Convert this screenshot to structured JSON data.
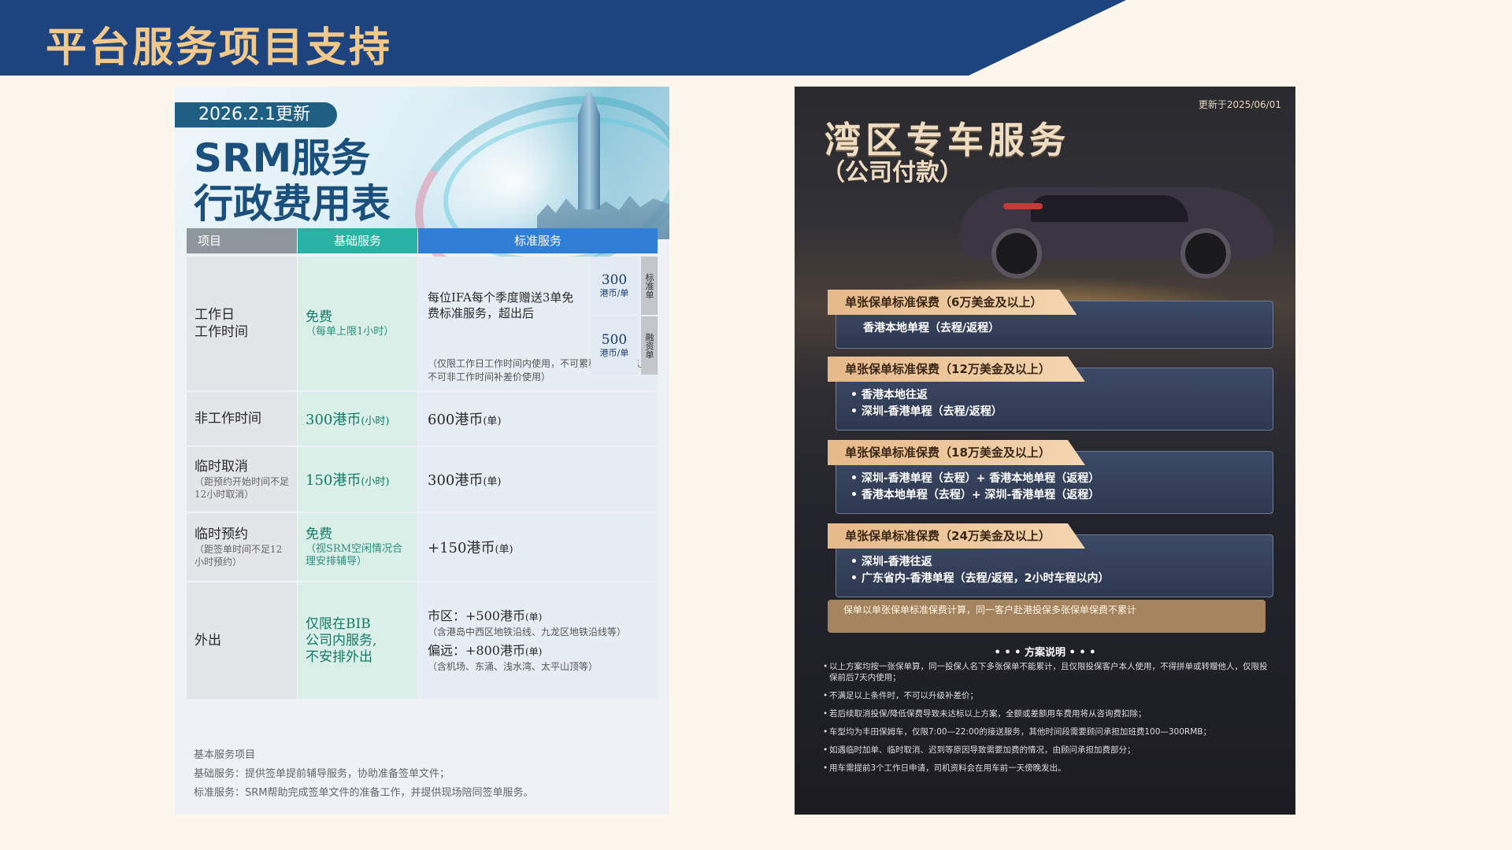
{
  "page_title": "平台服务项目支持",
  "srm": {
    "update_badge": "2026.2.1更新",
    "title_line1": "SRM服务",
    "title_line2": "行政费用表",
    "headers": {
      "item": "项目",
      "basic": "基础服务",
      "standard": "标准服务"
    },
    "rows": {
      "workday": {
        "label_line1": "工作日",
        "label_line2": "工作时间",
        "basic_main": "免费",
        "basic_sub": "（每单上限1小时）",
        "standard_desc": "每位IFA每个季度赠送3单免费标准服务，超出后",
        "price1": {
          "amount": "300",
          "unit": "港币/单",
          "tag": "标准单"
        },
        "price2": {
          "amount": "500",
          "unit": "港币/单",
          "tag": "融资单"
        },
        "standard_note": "（仅限工作日工作时间内使用，不可累积，不可转让，不可非工作时间补差价使用）"
      },
      "offhours": {
        "label": "非工作时间",
        "basic_value": "300港币",
        "basic_unit": "(小时)",
        "standard_value": "600港币",
        "standard_unit": "(单)"
      },
      "cancel": {
        "label": "临时取消",
        "label_sub": "（距预约开始时间不足12小时取消）",
        "basic_value": "150港币",
        "basic_unit": "(小时)",
        "standard_value": "300港币",
        "standard_unit": "(单)"
      },
      "booking": {
        "label": "临时预约",
        "label_sub": "（距签单时间不足12小时预约）",
        "basic_main": "免费",
        "basic_sub": "（视SRM空闲情况合理安排辅导）",
        "standard_value": "+150港币",
        "standard_unit": "(单)"
      },
      "outing": {
        "label": "外出",
        "basic_line1": "仅限在BIB",
        "basic_line2": "公司内服务,",
        "basic_line3": "不安排外出",
        "urban_value": "市区：+500港币",
        "urban_unit": "(单)",
        "urban_note": "（含港岛中西区地铁沿线、九龙区地铁沿线等）",
        "remote_value": "偏远：+800港币",
        "remote_unit": "(单)",
        "remote_note": "（含机场、东涌、浅水湾、太平山顶等）"
      }
    },
    "notes": {
      "heading": "基本服务项目",
      "basic": "基础服务：提供签单提前辅导服务，协助准备签单文件；",
      "standard": "标准服务：SRM帮助完成签单文件的准备工作，并提供现场陪同签单服务。"
    }
  },
  "car": {
    "updated": "更新于2025/06/01",
    "title": "湾区专车服务",
    "subtitle": "（公司付款）",
    "plans": [
      {
        "tag": "单张保单标准保费（6万美金及以上）",
        "lines": [
          "香港本地单程（去程/返程）"
        ]
      },
      {
        "tag": "单张保单标准保费（12万美金及以上）",
        "lines": [
          "• 香港本地往返",
          "• 深圳-香港单程（去程/返程）"
        ]
      },
      {
        "tag": "单张保单标准保费（18万美金及以上）",
        "lines": [
          "• 深圳-香港单程（去程）+ 香港本地单程（返程）",
          "• 香港本地单程（去程）+ 深圳-香港单程（返程）"
        ]
      },
      {
        "tag": "单张保单标准保费（24万美金及以上）",
        "lines": [
          "• 深圳-香港往返",
          "• 广东省内-香港单程（去程/返程，2小时车程以内）"
        ]
      }
    ],
    "note": "保单以单张保单标准保费计算，同一客户赴港投保多张保单保费不累计",
    "explain_title": "• • •  方案说明  • • •",
    "explain_items": [
      "以上方案均按一张保单算，同一投保人名下多张保单不能累计，且仅限投保客户本人使用，不得拼单或转赠他人，仅限投保前后7天内使用；",
      "不满足以上条件时，不可以升级补差价；",
      "若后续取消投保/降低保费导致未达标以上方案，全额或差额用车费用将从咨询费扣除；",
      "车型均为丰田保姆车，仅限7:00—22:00的接送服务，其他时间段需要顾问承担加班费100—300RMB；",
      "如遇临时加单、临时取消、迟到等原因导致需要加费的情况，由顾问承担加费部分；",
      "用车需提前3个工作日申请，司机资料会在用车前一天傍晚发出。"
    ]
  }
}
